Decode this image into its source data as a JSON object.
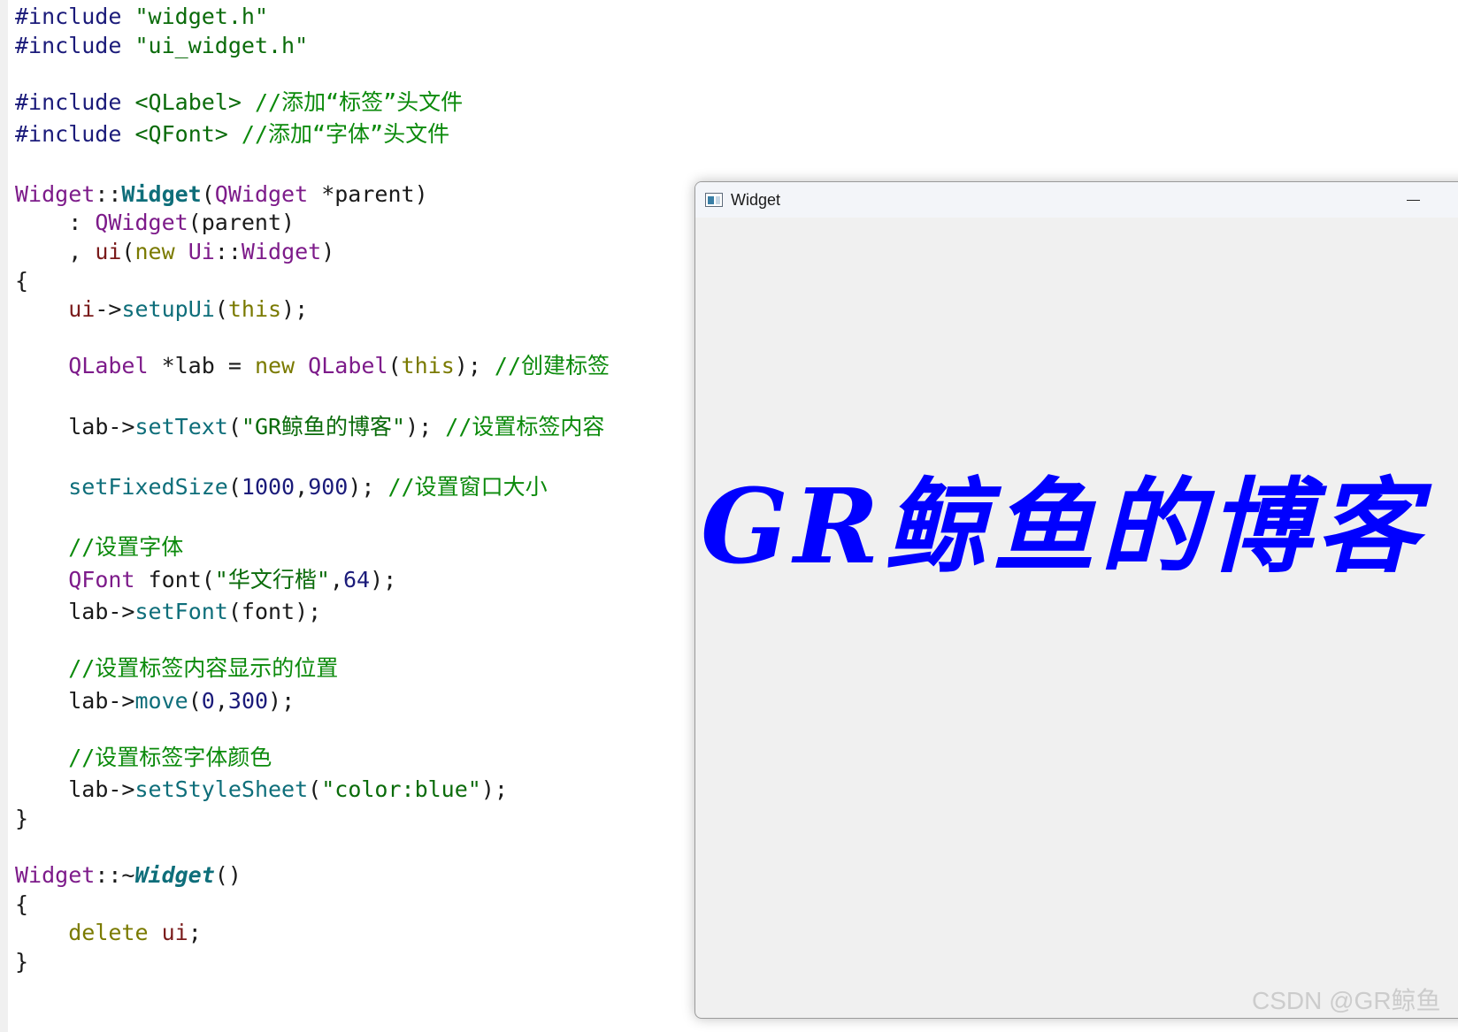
{
  "editor": {
    "line1": {
      "pp": "#include",
      "str": "\"widget.h\""
    },
    "line2": {
      "pp": "#include",
      "str": "\"ui_widget.h\""
    },
    "line3": {
      "pp": "#include",
      "hdr": "<QLabel>",
      "com": "//添加“标签”头文件"
    },
    "line4": {
      "pp": "#include",
      "hdr": "<QFont>",
      "com": "//添加“字体”头文件"
    },
    "ctor_decl": {
      "cls": "Widget",
      "sep": "::",
      "name": "Widget",
      "open": "(",
      "ptype": "QWidget",
      "pname": " *parent",
      "close": ")"
    },
    "init1": {
      "lead": "    : ",
      "base": "QWidget",
      "args": "(parent)"
    },
    "init2": {
      "lead": "    , ",
      "mem": "ui",
      "open": "(",
      "kw": "new",
      "sp": " ",
      "ns": "Ui",
      "sep": "::",
      "cls": "Widget",
      "close": ")"
    },
    "brace_open": "{",
    "setup": {
      "lead": "    ",
      "mem": "ui",
      "arrow": "->",
      "fn": "setupUi",
      "open": "(",
      "kw": "this",
      "close": ");"
    },
    "newlabel": {
      "lead": "    ",
      "type": "QLabel",
      "decl": " *lab = ",
      "kw": "new",
      "sp": " ",
      "type2": "QLabel",
      "open": "(",
      "kw2": "this",
      "close": "); ",
      "com": "//创建标签"
    },
    "settext": {
      "lead": "    ",
      "id": "lab->",
      "fn": "setText",
      "open": "(",
      "str": "\"GR鲸鱼的博客\"",
      "close": "); ",
      "com": "//设置标签内容"
    },
    "setsize": {
      "lead": "    ",
      "fn": "setFixedSize",
      "open": "(",
      "n1": "1000",
      "comma": ",",
      "n2": "900",
      "close": "); ",
      "com": "//设置窗口大小"
    },
    "c_font": "    //设置字体",
    "qfont": {
      "lead": "    ",
      "type": "QFont",
      "decl": " font(",
      "str": "\"华文行楷\"",
      "comma": ",",
      "num": "64",
      "close": ");"
    },
    "setfont": {
      "lead": "    ",
      "id": "lab->",
      "fn": "setFont",
      "args": "(font);"
    },
    "c_pos": "    //设置标签内容显示的位置",
    "move": {
      "lead": "    ",
      "id": "lab->",
      "fn": "move",
      "open": "(",
      "n1": "0",
      "comma": ",",
      "n2": "300",
      "close": ");"
    },
    "c_color": "    //设置标签字体颜色",
    "style": {
      "lead": "    ",
      "id": "lab->",
      "fn": "setStyleSheet",
      "open": "(",
      "str": "\"color:blue\"",
      "close": ");"
    },
    "brace_close": "}",
    "dtor_decl": {
      "cls": "Widget",
      "sep": "::~",
      "name": "Widget",
      "args": "()"
    },
    "brace_open2": "{",
    "del": {
      "lead": "    ",
      "kw": "delete",
      "sp": " ",
      "mem": "ui",
      "semi": ";"
    },
    "brace_close2": "}"
  },
  "window": {
    "title": "Widget",
    "minimize_icon": "minimize-icon",
    "app_icon": "qt-app-icon",
    "label_text": "GR鲸鱼的博客",
    "label_color": "#0000ff",
    "background": "#f0f0f0"
  },
  "watermark": "CSDN @GR鲸鱼"
}
